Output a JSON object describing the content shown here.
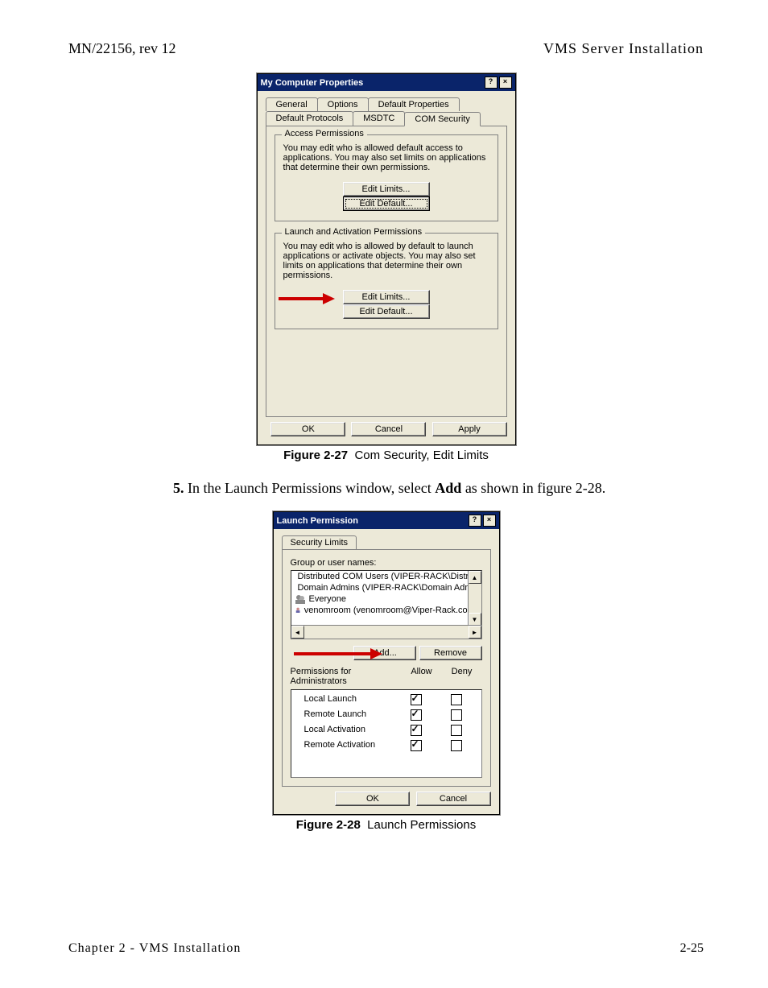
{
  "header": {
    "left": "MN/22156, rev 12",
    "right": "VMS Server Installation"
  },
  "footer": {
    "left": "Chapter 2 - VMS Installation",
    "right": "2-25"
  },
  "fig1": {
    "caption_label": "Figure 2-27",
    "caption_text": "Com Security, Edit Limits",
    "title": "My Computer Properties",
    "tabs_back": [
      "General",
      "Options",
      "Default Properties"
    ],
    "tabs_front": [
      "Default Protocols",
      "MSDTC",
      "COM Security"
    ],
    "group1": {
      "legend": "Access Permissions",
      "text": "You may edit who is allowed default access to applications. You may also set limits on applications that determine their own permissions.",
      "btn1": "Edit Limits...",
      "btn2": "Edit Default..."
    },
    "group2": {
      "legend": "Launch and Activation Permissions",
      "text": "You may edit who is allowed by default to launch applications or activate objects. You may also set limits on applications that determine their own permissions.",
      "btn1": "Edit Limits...",
      "btn2": "Edit Default..."
    },
    "ok": "OK",
    "cancel": "Cancel",
    "apply": "Apply"
  },
  "step": {
    "num": "5.",
    "text_a": "In the Launch Permissions window, select ",
    "bold": "Add",
    "text_b": " as shown in figure 2-28."
  },
  "fig2": {
    "caption_label": "Figure 2-28",
    "caption_text": "Launch Permissions",
    "title": "Launch Permission",
    "tab": "Security Limits",
    "group_label": "Group or user names:",
    "items": [
      "Distributed COM Users (VIPER-RACK\\Distributed COM Us",
      "Domain Admins (VIPER-RACK\\Domain Admins)",
      "Everyone",
      "venomroom (venomroom@Viper-Rack.com)"
    ],
    "add": "Add...",
    "remove": "Remove",
    "perms_label": "Permissions for Administrators",
    "allow": "Allow",
    "deny": "Deny",
    "perms": [
      {
        "name": "Local Launch",
        "allow": true,
        "deny": false
      },
      {
        "name": "Remote Launch",
        "allow": true,
        "deny": false
      },
      {
        "name": "Local Activation",
        "allow": true,
        "deny": false
      },
      {
        "name": "Remote Activation",
        "allow": true,
        "deny": false
      }
    ],
    "ok": "OK",
    "cancel": "Cancel"
  }
}
